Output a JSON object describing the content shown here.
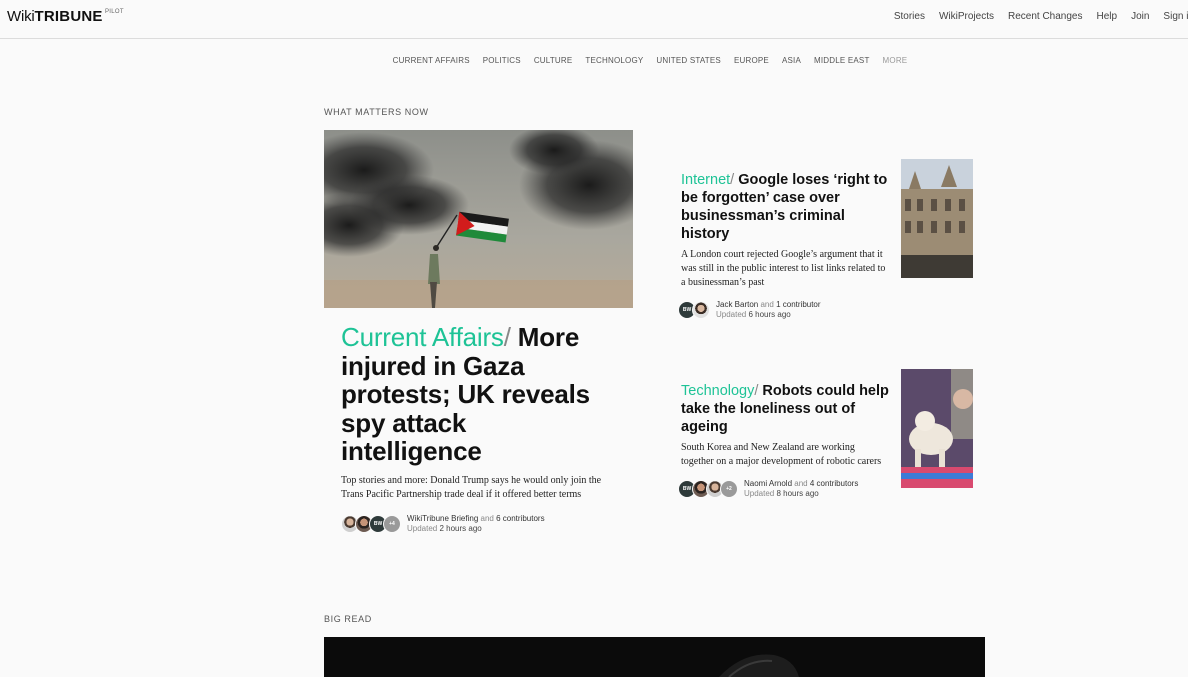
{
  "header": {
    "logo_wiki": "Wiki",
    "logo_tribune": "TRIBUNE",
    "logo_pilot": "PILOT",
    "nav": [
      "Stories",
      "WikiProjects",
      "Recent Changes",
      "Help",
      "Join",
      "Sign in"
    ]
  },
  "sections": [
    "CURRENT AFFAIRS",
    "POLITICS",
    "CULTURE",
    "TECHNOLOGY",
    "UNITED STATES",
    "EUROPE",
    "ASIA",
    "MIDDLE EAST",
    "MORE"
  ],
  "what_matters": {
    "label": "WHAT MATTERS NOW",
    "hero": {
      "category": "Current Affairs",
      "slash": "/",
      "headline": "More injured in Gaza protests; UK reveals spy attack intelligence",
      "description": "Top stories and more: Donald Trump says he would only join the Trans Pacific Partnership trade deal if it offered better terms",
      "author": "WikiTribune Briefing",
      "and": "and",
      "contributors": "6 contributors",
      "updated_prefix": "Updated",
      "updated": "2 hours ago",
      "avatar_initials": "BW",
      "avatar_more": "+4"
    },
    "stories": [
      {
        "category": "Internet",
        "slash": "/",
        "headline": "Google loses ‘right to be forgotten’ case over businessman’s criminal history",
        "description": "A London court rejected Google’s argument that it was still in the public interest to list links related to a businessman’s past",
        "author": "Jack Barton",
        "and": "and",
        "contributors": "1 contributor",
        "updated_prefix": "Updated",
        "updated": "6 hours ago",
        "avatar_initials": "BW"
      },
      {
        "category": "Technology",
        "slash": "/",
        "headline": "Robots could help take the loneliness out of ageing",
        "description": "South Korea and New Zealand are working together on a major development of robotic carers",
        "author": "Naomi Arnold",
        "and": "and",
        "contributors": "4 contributors",
        "updated_prefix": "Updated",
        "updated": "8 hours ago",
        "avatar_initials": "BW",
        "avatar_more": "+2"
      }
    ]
  },
  "big_read": {
    "label": "BIG READ"
  },
  "colors": {
    "accent": "#1ec396",
    "text": "#111111",
    "background": "#fafafa"
  }
}
